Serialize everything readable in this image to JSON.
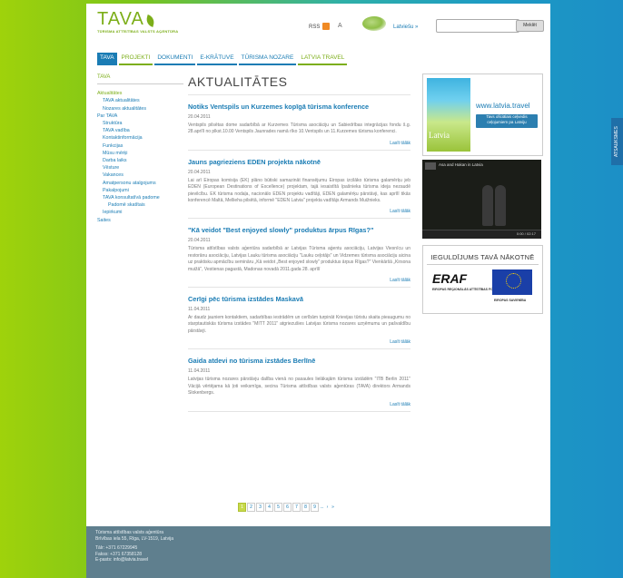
{
  "header": {
    "logo": "TAVA",
    "logo_sub": "TŪRISMA ATTĪSTĪBAS VALSTS AĢENTŪRA",
    "rss_label": "RSS",
    "font_label": "A",
    "language_link": "Latviešu »",
    "search_placeholder": "",
    "search_button": "Meklēt"
  },
  "nav": {
    "tabs": [
      "TAVA",
      "PROJEKTI",
      "DOKUMENTI",
      "E-KRĀTUVE",
      "TŪRISMA NOZARE",
      "LATVIA TRAVEL"
    ]
  },
  "sidebar": {
    "heading": "TAVA",
    "items": [
      "Aktualitātes",
      "TAVA aktualitātes",
      "Nozares aktualitātes",
      "Par TAVA",
      "Struktūra",
      "TAVA vadība",
      "Kontaktinformācija",
      "Funkcijas",
      "Mūsu mērķi",
      "Darba laiks",
      "Vēsture",
      "Vakances",
      "Amatpersonu atalgojums",
      "Pakalpojumi",
      "TAVA konsultatīvā padome",
      "Padomē skatītais",
      "Iepirkumi",
      "Saites"
    ]
  },
  "main": {
    "title": "AKTUALITĀTES",
    "read_more": "Lasīt tālāk",
    "articles": [
      {
        "title": "Notiks Ventspils un Kurzemes kopīgā tūrisma konference",
        "date": "20.04.2011",
        "body": "Ventspils pilsētas dome sadarbībā ar Kurzemes Tūrisma asociāciju un Sabiedrības integrācijas fondu š.g. 28.aprīlī no plkst.10.00 Ventspils Jaunrades namā rīko 10.Ventspils un 11.Kurzemes tūrisma konferenci."
      },
      {
        "title": "Jauns pagrieziens EDEN projekta nākotnē",
        "date": "20.04.2011",
        "body": "Lai arī Eiropas komisija (EK) plāno būtiski samazināt finansējumu Eiropas izcilāko tūrisma galamērķu jeb EDEN (European Destinations of Excellence) projektam, tajā iesaistītā īpašnieka tūrisma ideja nezaudē pievilcību. EK tūrisma nodaļa, nacionālo EDEN projektu vadītāji, EDEN galamērķu pārstāvji, kas aprīlī tikās konferencē Maltā, Mellieha pilsētā, informē \"EDEN Latvia\" projekta vadītājs Armands Muižnieks."
      },
      {
        "title": "\"Kā veidot \"Best enjoyed slowly\" produktus ārpus Rīgas?\"",
        "date": "20.04.2011",
        "body": "Tūrisma attīstības valsts aģentūra sadarbībā ar Latvijas Tūrisma aģentu asociāciju, Latvijas Viesnīcu un restorānu asociāciju, Latvijas Lauku tūrisma asociāciju \"Lauku ceļotājs\" un Vidzemes tūrisma asociāciju aicina uz praktisku apmācību semināru „Kā veidot „Best enjoyed slowly\" produktus ārpus Rīgas?\" Vienkāršā „Kirsona muižā\", Vestienas pagastā, Madonas novadā 2011.gada 28. aprīlī"
      },
      {
        "title": "Cerīgi pēc tūrisma izstādes Maskavā",
        "date": "11.04.2011",
        "body": "Ar daudz jauniem kontaktiem, sadarbības iestrādēm un cerībām turpināt Krievijas tūristu skaita pieaugumu no starptautiskās tūrisma izstādes \"MITT 2011\" atgriezušies Latvijas tūrisma nozares uzņēmumu un pašvaldību pārstāvji."
      },
      {
        "title": "Gaida atdevi no tūrisma izstādes Berlīnē",
        "date": "11.04.2011",
        "body": "Latvijas tūrisma nozares pārstāvju dalība vienā no pasaules lielākajām tūrisma izstādēm \"ITB Berlin 2011\" Vācijā vērtējama kā ļoti veiksmīga, secina Tūrisma attīstības valsts aģentūras (TAVA) direktors Armands Slokenbergs."
      }
    ],
    "pagination": [
      "1",
      "2",
      "3",
      "4",
      "5",
      "6",
      "7",
      "8",
      "9",
      "...",
      "›",
      "»"
    ]
  },
  "ads": {
    "latvia_url": "www.latvia.travel",
    "latvia_badge": "Tavs oficiālais ceļvedis ceļojumiem pa Latviju",
    "latvia_logo": "Latvia",
    "video_title": "Asa and Hakan in Latvia",
    "video_time": "0:00 / 02:17",
    "eraf_heading": "IEGULDĪJUMS TAVĀ NĀKOTNĒ",
    "eraf_logo": "ERAF",
    "eraf_sub": "EIROPAS REĢIONĀLĀS ATTĪSTĪBAS FONDS",
    "eu_sub": "EIROPAS SAVIENĪBA"
  },
  "side_tab": "ATSAUKSMES",
  "footer": {
    "lines": [
      "Tūrisma attīstības valsts aģentūra",
      "Brīvības iela 55, Rīga, LV-1519, Latvija",
      "",
      "Tālr: +371 67229945",
      "Fakss: +371 67358128",
      "E-pasts: info@latvia.travel"
    ]
  },
  "colors": {
    "brand_green": "#7cae19",
    "link_blue": "#1a7cb4",
    "footer_bg": "#5f7f8e"
  }
}
